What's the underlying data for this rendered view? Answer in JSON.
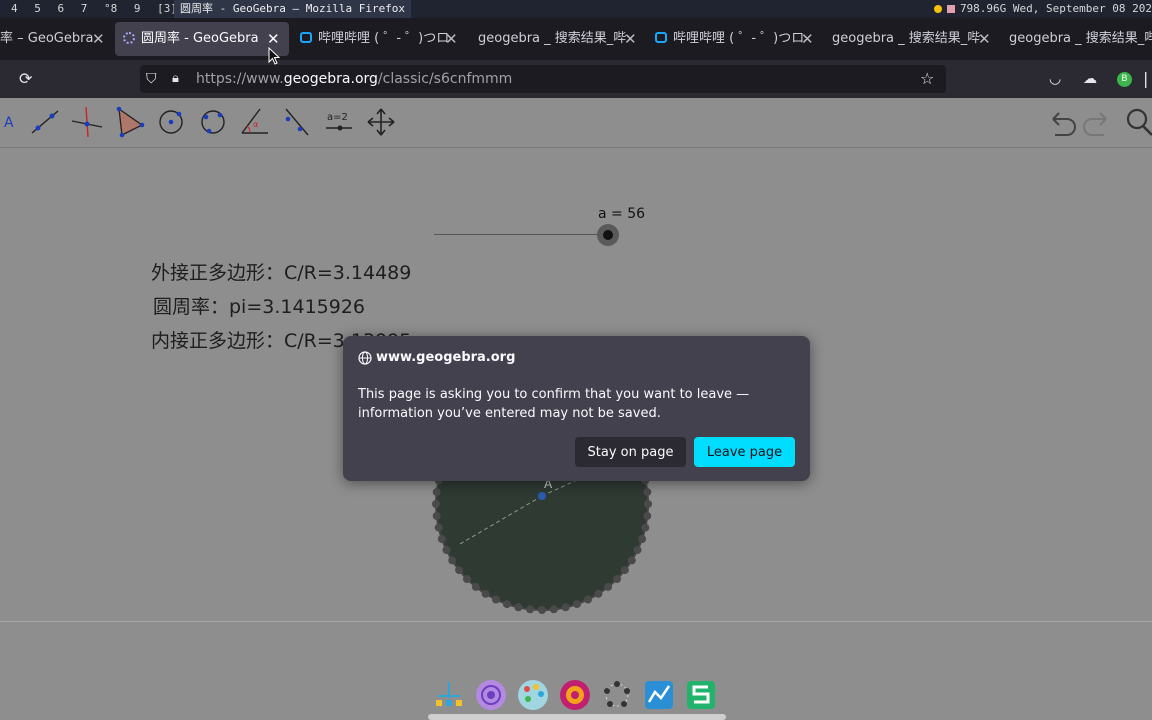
{
  "sysbar": {
    "workspaces": [
      "4",
      "5",
      "6",
      "7",
      "°8",
      "9",
      "[3]"
    ],
    "window_title": "圆周率 - GeoGebra — Mozilla Firefox",
    "status": "798.96G Wed, September 08 202"
  },
  "tabs": [
    {
      "label": "率 – GeoGebra"
    },
    {
      "label": "圆周率 - GeoGebra",
      "active": true
    },
    {
      "label": "哔哩哔哩 ( ゜- ゜)つロ"
    },
    {
      "label": "geogebra _ 搜索结果_哔"
    },
    {
      "label": "哔哩哔哩 ( ゜- ゜)つロ"
    },
    {
      "label": "geogebra _ 搜索结果_哔"
    },
    {
      "label": "geogebra _ 搜索结果_哔"
    }
  ],
  "urlbar": {
    "prefix": "https://www.",
    "domain": "geogebra.org",
    "path": "/classic/s6cnfmmm"
  },
  "toolbar": {
    "tools": [
      "move-tool",
      "point-tool",
      "line-tool",
      "perpendicular-tool",
      "polygon-tool",
      "circle-tool",
      "conic-tool",
      "angle-tool",
      "reflect-tool",
      "slider-tool",
      "move-view-tool"
    ],
    "slider_tool_label": "a=2"
  },
  "canvas": {
    "slider_label": "a = 56",
    "text_outer": "外接正多边形：C/R=3.14489",
    "text_pi": "圆周率：pi=3.1415926",
    "text_inner": "内接正多边形：C/R=3.13995",
    "point_label": "A"
  },
  "dialog": {
    "host": "www.geogebra.org",
    "message": "This page is asking you to confirm that you want to leave — information you’ve entered may not be saved.",
    "stay_label": "Stay on page",
    "leave_label": "Leave page"
  },
  "colors": {
    "leave_button": "#00ddff",
    "dialog_bg": "#42414d",
    "circle_fill": "#2f3a33"
  }
}
